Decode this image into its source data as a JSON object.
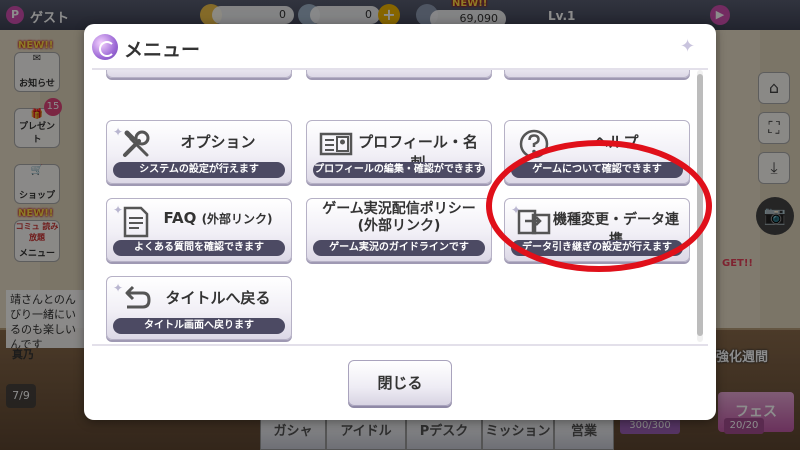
{
  "topbar": {
    "guest_icon": "P",
    "guest_label": "ゲスト",
    "stat1_value": "0",
    "stat2_value": "0",
    "new_label": "NEW!!",
    "stat3_value": "69,090",
    "level": "Lv.1",
    "next_icon": "▶"
  },
  "left_sidebar": {
    "new_label": "NEW!!",
    "items": [
      {
        "label": "お知らせ"
      },
      {
        "label": "プレゼント",
        "badge": "15"
      },
      {
        "label": "ショップ"
      },
      {
        "label": "メニュー",
        "extra": "コミュ 読み放題"
      }
    ],
    "chat_text": "靖さんとのんびり一緒にいるのも楽しいんです",
    "chat_name": "真乃",
    "page_indicator": "7/9"
  },
  "right_sidebar": {
    "event_get": "GET!!",
    "event_week": "強化週間"
  },
  "bottom_nav": {
    "items": [
      "ガシャ",
      "アイドル",
      "Pデスク",
      "ミッション",
      "営業"
    ],
    "stamina": "300/300",
    "fes_count": "20/20",
    "fes_label": "フェス"
  },
  "menu_modal": {
    "title": "メニュー",
    "buttons": [
      {
        "title": "オプション",
        "desc": "システムの設定が行えます"
      },
      {
        "title": "プロフィール・名刺",
        "desc": "プロフィールの編集・確認ができます"
      },
      {
        "title": "ヘルプ",
        "desc": "ゲームについて確認できます"
      },
      {
        "title": "FAQ",
        "title_small": "(外部リンク)",
        "desc": "よくある質問を確認できます"
      },
      {
        "title_line1": "ゲーム実況配信ポリシー",
        "title_line2": "(外部リンク)",
        "desc": "ゲーム実況のガイドラインです"
      },
      {
        "title": "機種変更・データ連携",
        "desc": "データ引き継ぎの設定が行えます"
      },
      {
        "title": "タイトルへ戻る",
        "desc": "タイトル画面へ戻ります"
      }
    ],
    "close_label": "閉じる"
  }
}
